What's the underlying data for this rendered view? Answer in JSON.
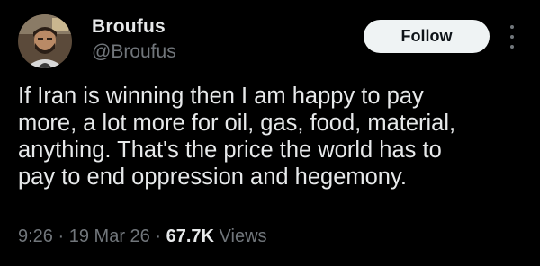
{
  "author": {
    "name": "Broufus",
    "handle": "@Broufus"
  },
  "follow_label": "Follow",
  "more_icon": "more-vertical-icon",
  "tweet": {
    "lines": [
      "If Iran is winning then I am happy to pay",
      "more, a lot more for oil, gas, food, material,",
      "anything. That's the price the world has to",
      "pay to end oppression and hegemony."
    ]
  },
  "meta": {
    "time": "9:26",
    "separator": "·",
    "date": "19 Mar 26",
    "views_count": "67.7K",
    "views_label": "Views"
  },
  "colors": {
    "background": "#000000",
    "text": "#e7e9ea",
    "secondary": "#71767b",
    "button_bg": "#eff3f4",
    "button_text": "#0f1419"
  }
}
